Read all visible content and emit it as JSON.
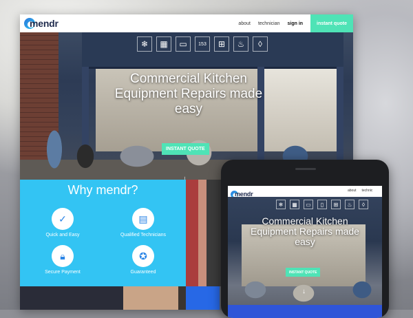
{
  "desktop": {
    "nav": {
      "logo": "mendr",
      "links": [
        "about",
        "technician"
      ],
      "signin": "sign in",
      "cta": "instant quote"
    },
    "hero": {
      "title": "Commercial Kitchen Equipment Repairs made easy",
      "cta": "INSTANT QUOTE",
      "tile_number": "153"
    },
    "why": {
      "title": "Why mendr?",
      "features": [
        {
          "label": "Quick and Easy",
          "icon": "checkmark-icon"
        },
        {
          "label": "Qualified Technicians",
          "icon": "id-card-icon"
        },
        {
          "label": "Secure Payment",
          "icon": "lock-icon"
        },
        {
          "label": "Guaranteed",
          "icon": "award-ribbon-icon"
        }
      ]
    }
  },
  "phone": {
    "nav": {
      "logo": "mendr",
      "links": [
        "about",
        "technic"
      ]
    },
    "hero": {
      "title": "Commercial Kitchen Equipment Repairs made easy",
      "cta": "INSTANT QUOTE"
    }
  },
  "colors": {
    "accent": "#4fe3b6",
    "why_bg": "#33c4f3",
    "brand_dark": "#1f2b4d",
    "stripe": "#1f3db8"
  }
}
